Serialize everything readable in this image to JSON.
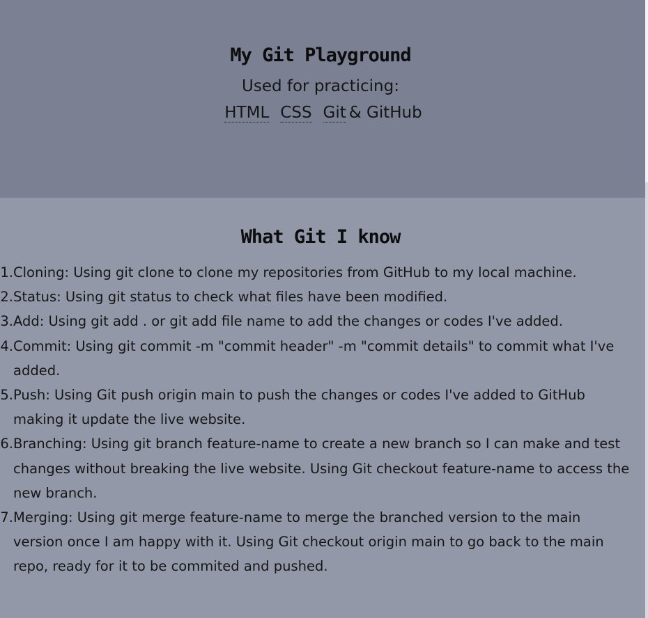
{
  "hero": {
    "title": "My Git Playground",
    "subtitle": "Used for practicing:",
    "links": {
      "html": "HTML",
      "css": "CSS",
      "git": "Git",
      "github_suffix": "& GitHub"
    }
  },
  "section": {
    "title": "What Git I know",
    "items": [
      {
        "num": "1.",
        "text": "Cloning: Using git clone to clone my repositories from GitHub to my local machine."
      },
      {
        "num": "2.",
        "text": "Status: Using git status to check what files have been modified."
      },
      {
        "num": "3.",
        "text": "Add: Using git add . or git add file name to add the changes or codes I've added."
      },
      {
        "num": "4.",
        "text": "Commit: Using git commit -m \"commit header\" -m \"commit details\" to commit what I've added."
      },
      {
        "num": "5.",
        "text": "Push: Using Git push origin main to push the changes or codes I've added to GitHub making it update the live website."
      },
      {
        "num": "6.",
        "text": "Branching: Using git branch feature-name to create a new branch so I can make and test changes without breaking the live website. Using Git checkout feature-name to access the new branch."
      },
      {
        "num": "7.",
        "text": "Merging: Using git merge feature-name to merge the branched version to the main version once I am happy with it. Using Git checkout origin main to go back to the main repo, ready for it to be commited and pushed."
      }
    ]
  },
  "colors": {
    "hero_bg": "#7b8193",
    "content_bg": "#9398a9",
    "text": "#161616"
  }
}
